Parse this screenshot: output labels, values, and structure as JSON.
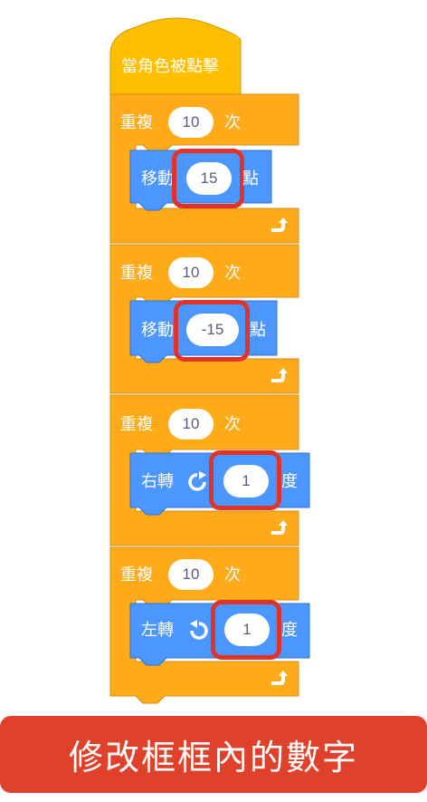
{
  "hat": {
    "label": "當角色被點擊"
  },
  "loops": [
    {
      "repeat_label": "重複",
      "count": "10",
      "times_label": "次",
      "inner": {
        "label": "移動",
        "value": "15",
        "suffix": "點"
      }
    },
    {
      "repeat_label": "重複",
      "count": "10",
      "times_label": "次",
      "inner": {
        "label": "移動",
        "value": "-15",
        "suffix": "點"
      }
    },
    {
      "repeat_label": "重複",
      "count": "10",
      "times_label": "次",
      "inner": {
        "label": "右轉",
        "icon": "rotate-clockwise-icon",
        "value": "1",
        "suffix": "度"
      }
    },
    {
      "repeat_label": "重複",
      "count": "10",
      "times_label": "次",
      "inner": {
        "label": "左轉",
        "icon": "rotate-counterclockwise-icon",
        "value": "1",
        "suffix": "度"
      }
    }
  ],
  "banner": {
    "text": "修改框框內的數字"
  },
  "colors": {
    "control": "#ffab19",
    "control_border": "#cf8b17",
    "events": "#ffbf00",
    "motion": "#4c97ff",
    "motion_border": "#3373cc",
    "highlight": "#e0332b",
    "banner": "#e0412b"
  }
}
